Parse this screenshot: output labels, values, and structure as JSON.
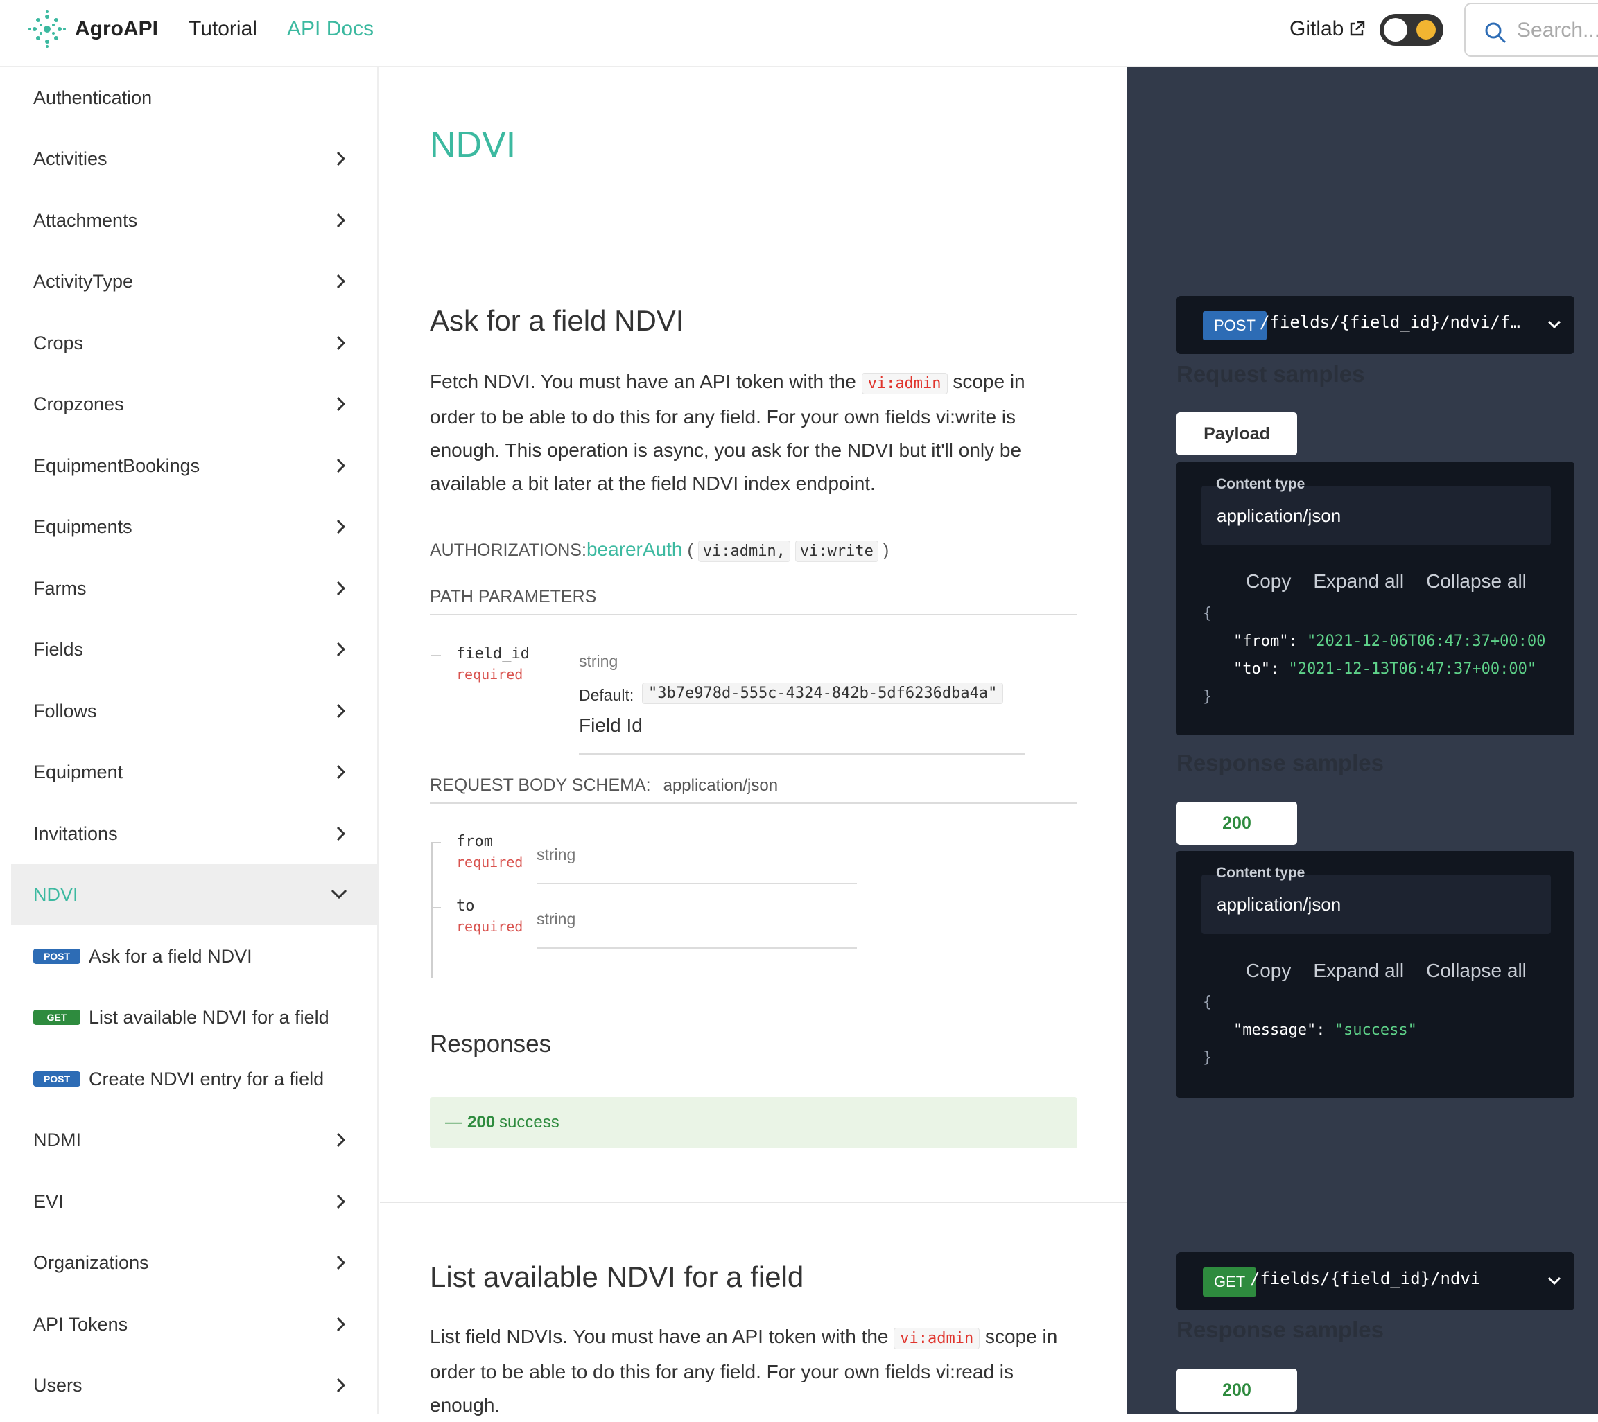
{
  "nav": {
    "brand": "AgroAPI",
    "links": [
      "Tutorial",
      "API Docs"
    ],
    "gitlab": "Gitlab",
    "search_placeholder": "Search..."
  },
  "sidebar": {
    "items": [
      "Authentication",
      "Activities",
      "Attachments",
      "ActivityType",
      "Crops",
      "Cropzones",
      "EquipmentBookings",
      "Equipments",
      "Farms",
      "Fields",
      "Follows",
      "Equipment",
      "Invitations",
      "NDVI"
    ],
    "ndvi_children": [
      {
        "method": "POST",
        "label": "Ask for a field NDVI"
      },
      {
        "method": "GET",
        "label": "List available NDVI for a field"
      },
      {
        "method": "POST",
        "label": "Create NDVI entry for a field"
      }
    ],
    "items_after": [
      "NDMI",
      "EVI",
      "Organizations",
      "API Tokens",
      "Users"
    ]
  },
  "main": {
    "page_title": "NDVI",
    "op1": {
      "title": "Ask for a field NDVI",
      "desc_before": "Fetch NDVI. You must have an API token with the",
      "desc_code": "vi:admin",
      "desc_after": "scope in order to be able to do this for any field. For your own fields vi:write is enough. This operation is async, you ask for the NDVI but it'll only be available a bit later at the field NDVI index endpoint.",
      "auth_label": "AUTHORIZATIONS:",
      "auth_scheme": "bearerAuth",
      "auth_paren_open": "(",
      "auth_scopes": [
        "vi:admin,",
        "vi:write"
      ],
      "auth_paren_close": ")",
      "path_params_label": "PATH PARAMETERS",
      "path_param": {
        "name": "field_id",
        "required": "required",
        "type": "string",
        "default_label": "Default:",
        "default_value": "\"3b7e978d-555c-4324-842b-5df6236dba4a\"",
        "description": "Field Id"
      },
      "body_label": "REQUEST BODY SCHEMA:",
      "body_content_type": "application/json",
      "body_params": [
        {
          "name": "from",
          "required": "required",
          "type": "string"
        },
        {
          "name": "to",
          "required": "required",
          "type": "string"
        }
      ],
      "responses_label": "Responses",
      "response": {
        "dash": "—",
        "code": "200",
        "text": "success"
      }
    },
    "op2": {
      "title": "List available NDVI for a field",
      "desc_before": "List field NDVIs. You must have an API token with the",
      "desc_code": "vi:admin",
      "desc_after": "scope in order to be able to do this for any field. For your own fields vi:read is enough."
    }
  },
  "right": {
    "op1": {
      "method": "POST",
      "path": "/fields/{field_id}/ndvi/f…",
      "request_samples": "Request samples",
      "payload_tab": "Payload",
      "content_type_label": "Content type",
      "content_type": "application/json",
      "actions": [
        "Copy",
        "Expand all",
        "Collapse all"
      ],
      "request_code": {
        "open": "{",
        "from_key": "\"from\":",
        "from_val": "\"2021-12-06T06:47:37+00:00",
        "to_key": "\"to\":",
        "to_val": "\"2021-12-13T06:47:37+00:00\"",
        "close": "}"
      },
      "response_samples": "Response samples",
      "status_tab": "200",
      "response_code": {
        "open": "{",
        "msg_key": "\"message\":",
        "msg_val": "\"success\"",
        "close": "}"
      }
    },
    "op2": {
      "method": "GET",
      "path": "/fields/{field_id}/ndvi",
      "response_samples": "Response samples",
      "status_tab": "200"
    }
  }
}
